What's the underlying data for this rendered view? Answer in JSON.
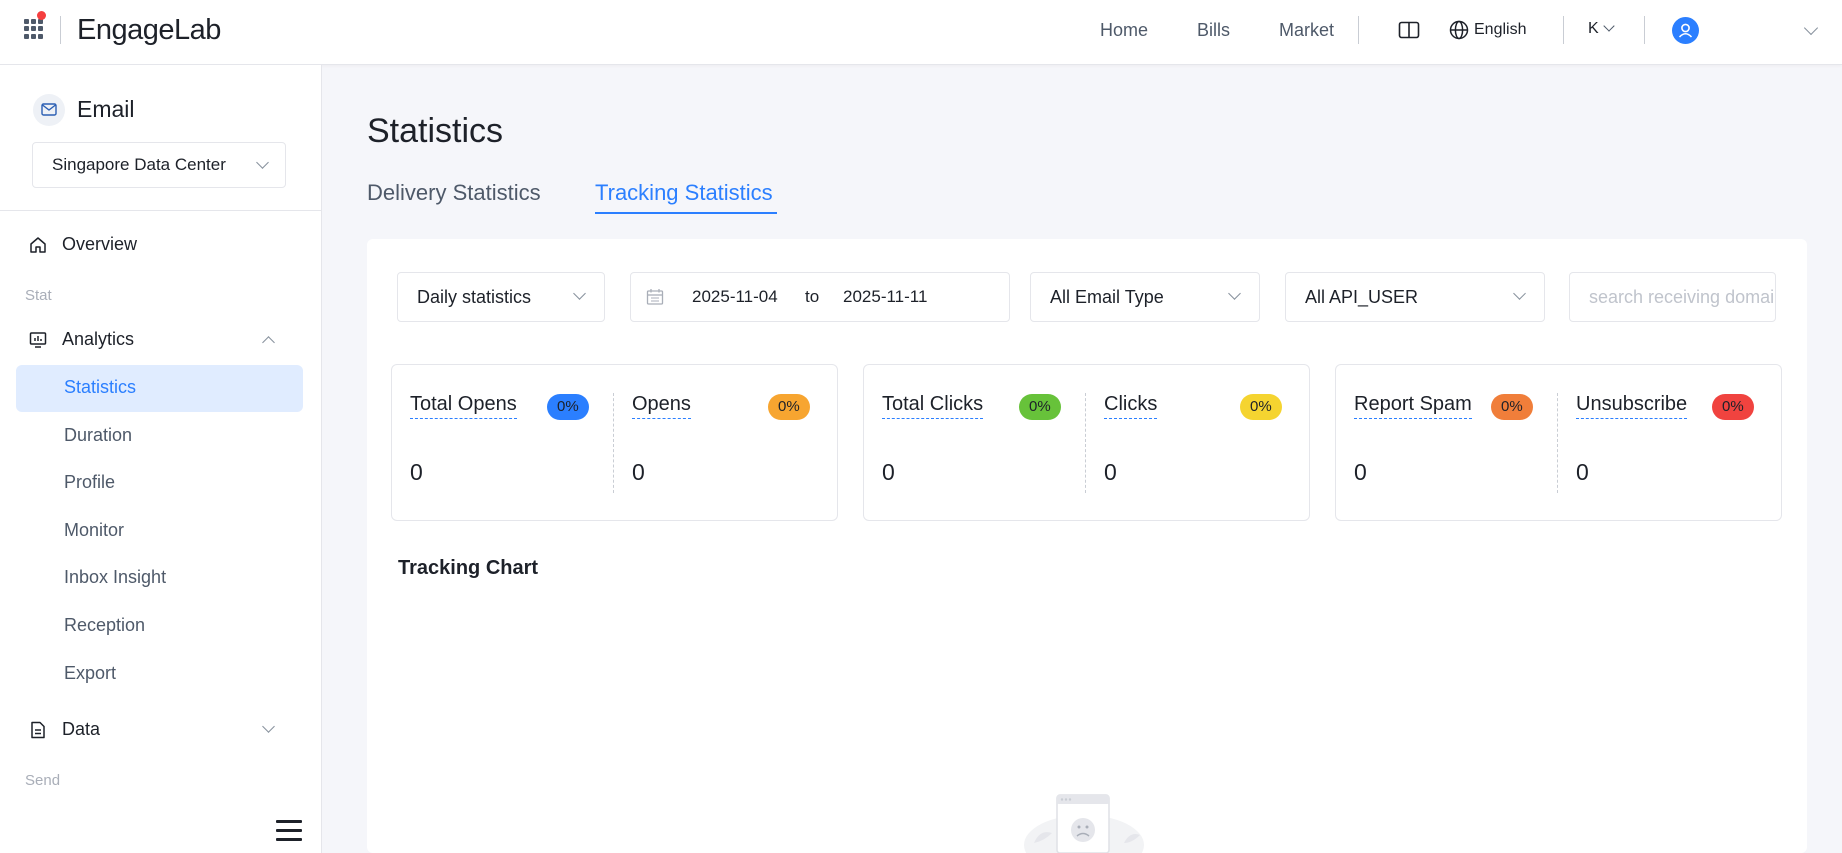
{
  "topbar": {
    "logo": "EngageLab",
    "nav": [
      "Home",
      "Bills",
      "Market"
    ],
    "language": "English",
    "user_initial": "K"
  },
  "sidebar": {
    "product_title": "Email",
    "data_center": "Singapore Data Center",
    "overview": "Overview",
    "group_stat": "Stat",
    "analytics": "Analytics",
    "analytics_items": [
      "Statistics",
      "Duration",
      "Profile",
      "Monitor",
      "Inbox Insight",
      "Reception",
      "Export"
    ],
    "data": "Data",
    "group_send": "Send"
  },
  "main": {
    "title": "Statistics",
    "tabs": [
      "Delivery Statistics",
      "Tracking Statistics"
    ],
    "active_tab": "Tracking Statistics",
    "filters": {
      "period": "Daily statistics",
      "date_start": "2025-11-04",
      "date_sep": "to",
      "date_end": "2025-11-11",
      "email_type": "All Email Type",
      "api_user": "All API_USER",
      "domain_placeholder": "search receiving domain"
    },
    "cards": [
      {
        "metrics": [
          {
            "label": "Total Opens",
            "badge": "0%",
            "badge_color": "#2b7fff",
            "value": "0"
          },
          {
            "label": "Opens",
            "badge": "0%",
            "badge_color": "#f7a530",
            "value": "0"
          }
        ]
      },
      {
        "metrics": [
          {
            "label": "Total Clicks",
            "badge": "0%",
            "badge_color": "#67c23a",
            "value": "0"
          },
          {
            "label": "Clicks",
            "badge": "0%",
            "badge_color": "#f5d430",
            "value": "0"
          }
        ]
      },
      {
        "metrics": [
          {
            "label": "Report Spam",
            "badge": "0%",
            "badge_color": "#f07e3a",
            "value": "0"
          },
          {
            "label": "Unsubscribe",
            "badge": "0%",
            "badge_color": "#f0433f",
            "value": "0"
          }
        ]
      }
    ],
    "chart_title": "Tracking Chart"
  },
  "colors": {
    "accent": "#2b7fff",
    "active_bg": "#e0ecff"
  }
}
